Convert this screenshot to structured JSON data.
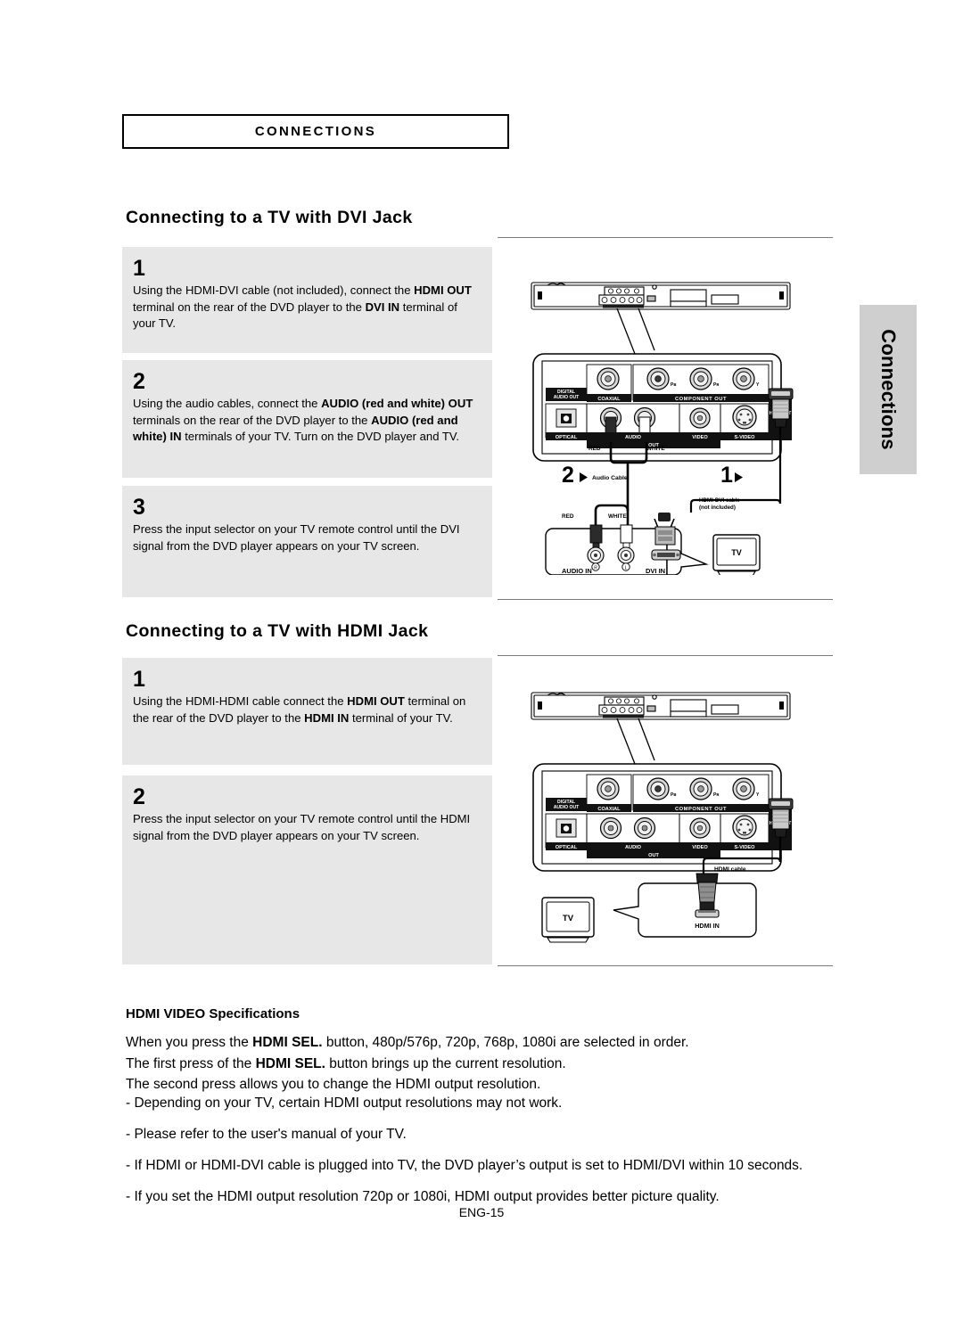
{
  "chapter": {
    "label": "CONNECTIONS"
  },
  "side_tab": {
    "label": "Connections"
  },
  "sections": [
    {
      "heading": "Connecting to a TV with DVI Jack",
      "steps": [
        {
          "num": "1",
          "html": "Using the HDMI-DVI cable (not included), connect the <b>HDMI OUT</b> terminal on the rear of the DVD player to the <b>DVI IN</b> terminal of your TV."
        },
        {
          "num": "2",
          "html": "Using the audio cables, connect the <b>AUDIO (red and white) OUT</b> terminals on the rear of the DVD player to the <b>AUDIO (red and white) IN</b> terminals of your TV. Turn on the DVD player and TV."
        },
        {
          "num": "3",
          "html": "Press the input selector on your TV remote control until the DVI signal from the DVD player appears on your TV screen."
        }
      ]
    },
    {
      "heading": "Connecting to a TV with HDMI Jack",
      "steps": [
        {
          "num": "1",
          "html": "Using the HDMI-HDMI cable connect the <b>HDMI OUT</b> terminal on the rear of the DVD player to the <b>HDMI IN</b> terminal of your TV."
        },
        {
          "num": "2",
          "html": "Press the input selector on your TV remote control until the HDMI signal from the DVD player appears on your TV screen."
        }
      ]
    }
  ],
  "spec": {
    "title": "HDMI VIDEO Specifications",
    "paragraph_html": "When you press the <b>HDMI SEL.</b> button, 480p/576p, 720p, 768p, 1080i are selected in order.<br>The first press of the <b>HDMI SEL.</b> button brings up the current resolution.<br>The second press allows you to change the HDMI output resolution.",
    "bullets": [
      "- Depending on your TV, certain HDMI output resolutions may not work.",
      "- Please refer to the user's manual of your TV.",
      "- If HDMI or HDMI-DVI cable is plugged into TV, the DVD player’s output is set to HDMI/DVI within 10 seconds.",
      "- If you set the HDMI output resolution 720p or 1080i, HDMI output provides better picture quality."
    ]
  },
  "footer": {
    "page": "ENG-15"
  },
  "diagram_dvi": {
    "panel_labels": {
      "digital_audio_out": "DIGITAL\nAUDIO OUT",
      "digital_audio_out_l1": "DIGITAL",
      "digital_audio_out_l2": "AUDIO OUT",
      "coaxial": "COAXIAL",
      "component_out": "COMPONENT OUT",
      "optical": "OPTICAL",
      "audio": "AUDIO",
      "video": "VIDEO",
      "svideo": "S-VIDEO",
      "out": "OUT",
      "hdmi_out": "HDMI OUT",
      "pb": "Pʙ",
      "pr": "Pʀ",
      "y": "Y"
    },
    "cable_labels": {
      "red_top": "RED",
      "white_top": "WHITE",
      "red_bottom": "RED",
      "white_bottom": "WHITE",
      "audio_cable": "Audio Cable",
      "hdmi_dvi_cable_l1": "HDMI-DVI cable",
      "hdmi_dvi_cable_l2": "(not included)",
      "step_marker_2": "2",
      "step_marker_1": "1"
    },
    "tv_labels": {
      "audio_in": "AUDIO IN",
      "dvi_in": "DVI IN",
      "tv": "TV",
      "r": "R",
      "l": "L"
    }
  },
  "diagram_hdmi": {
    "panel_labels": {
      "digital_audio_out_l1": "DIGITAL",
      "digital_audio_out_l2": "AUDIO OUT",
      "coaxial": "COAXIAL",
      "component_out": "COMPONENT OUT",
      "optical": "OPTICAL",
      "audio": "AUDIO",
      "video": "VIDEO",
      "svideo": "S-VIDEO",
      "out": "OUT",
      "hdmi_out": "HDMI OUT",
      "pb": "Pʙ",
      "pr": "Pʀ",
      "y": "Y"
    },
    "cable_labels": {
      "hdmi_cable": "HDMI cable"
    },
    "tv_labels": {
      "hdmi_in": "HDMI IN",
      "tv": "TV"
    }
  }
}
